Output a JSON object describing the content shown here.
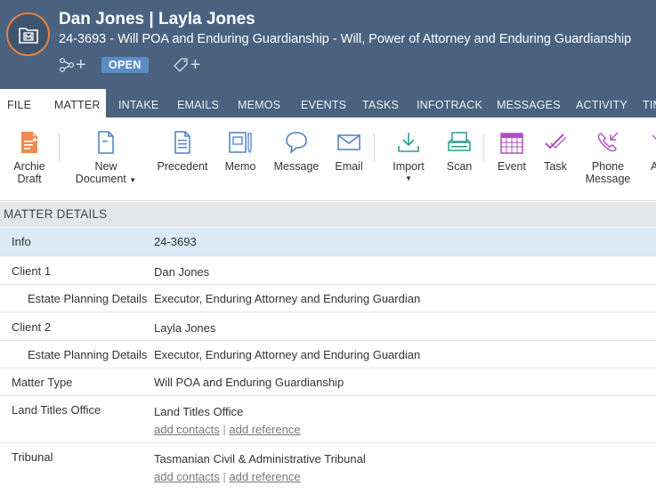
{
  "header": {
    "title": "Dan Jones | Layla Jones",
    "subtitle": "24-3693 - Will POA and Enduring Guardianship - Will, Power of Attorney and Enduring Guardianship",
    "status": "OPEN",
    "plus1": "+",
    "plus2": "+"
  },
  "tabs": {
    "file": "FILE",
    "matter": "MATTER",
    "intake": "INTAKE",
    "emails": "EMAILS",
    "memos": "MEMOS",
    "events": "EVENTS",
    "tasks": "TASKS",
    "infotrack": "INFOTRACK",
    "messages": "MESSAGES",
    "activity": "ACTIVITY",
    "time": "TIM"
  },
  "toolbar": {
    "archie_line1": "Archie",
    "archie_line2": "Draft",
    "new_doc_line1": "New",
    "new_doc_line2": "Document",
    "precedent": "Precedent",
    "memo": "Memo",
    "message": "Message",
    "email": "Email",
    "import": "Import",
    "scan": "Scan",
    "event": "Event",
    "task": "Task",
    "phone_line1": "Phone",
    "phone_line2": "Message",
    "cut_label": "A"
  },
  "section": {
    "title": "MATTER DETAILS"
  },
  "details": {
    "info_label": "Info",
    "info_value": "24-3693",
    "client1_label": "Client 1",
    "client1_value": "Dan Jones",
    "estate1_label": "Estate Planning Details",
    "estate1_value": "Executor, Enduring Attorney and Enduring Guardian",
    "client2_label": "Client 2",
    "client2_value": "Layla Jones",
    "estate2_label": "Estate Planning Details",
    "estate2_value": "Executor, Enduring Attorney and Enduring Guardian",
    "matter_type_label": "Matter Type",
    "matter_type_value": "Will POA and Enduring Guardianship",
    "land_label": "Land Titles Office",
    "land_value": "Land Titles Office",
    "tribunal_label": "Tribunal",
    "tribunal_value": "Tasmanian Civil & Administrative Tribunal",
    "add_contacts": "add contacts",
    "add_reference": "add reference",
    "link_sep": "|"
  },
  "colors": {
    "header_bg": "#4a6280",
    "accent_orange": "#e8813e",
    "badge_blue": "#5a8dc6",
    "icon_blue": "#4e7fbf",
    "icon_teal": "#2a9d8f",
    "icon_green": "#4caf50",
    "icon_purple": "#b04fc3",
    "highlight_row": "#dce9f6"
  }
}
